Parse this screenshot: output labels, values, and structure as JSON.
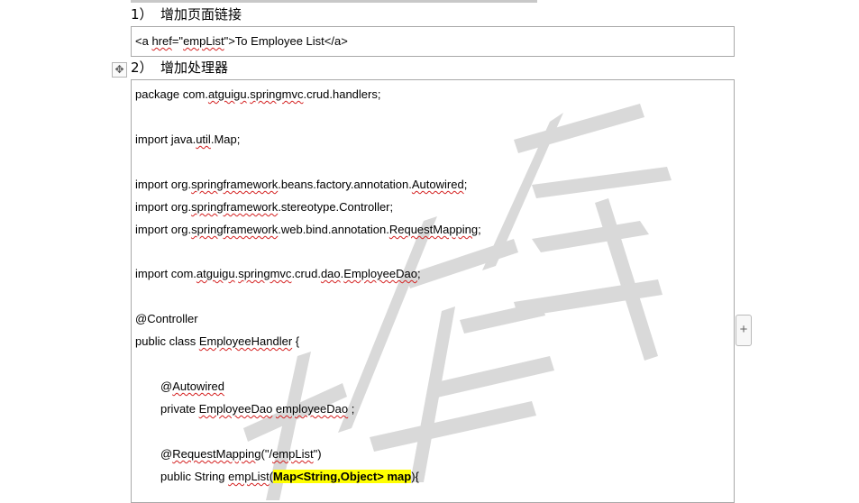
{
  "step1": {
    "number": "1）",
    "title": "增加页面链接",
    "code": "<a href=\"empList\">To Employee List</a>"
  },
  "step2": {
    "number": "2）",
    "title": "增加处理器"
  },
  "code": {
    "l1_a": "package com.",
    "l1_b": "atguigu",
    "l1_c": ".",
    "l1_d": "springmvc",
    "l1_e": ".crud.handlers;",
    "l2_a": "import java.",
    "l2_b": "util",
    "l2_c": ".Map;",
    "l3_a": "import org.",
    "l3_b": "springframework",
    "l3_c": ".beans.factory.annotation.",
    "l3_d": "Autowired",
    "l3_e": ";",
    "l4_a": "import org.",
    "l4_b": "springframework",
    "l4_c": ".stereotype.Controller;",
    "l5_a": "import org.",
    "l5_b": "springframework",
    "l5_c": ".web.bind.annotation.",
    "l5_d": "RequestMapping",
    "l5_e": ";",
    "l6_a": "import com.",
    "l6_b": "atguigu",
    "l6_c": ".",
    "l6_d": "springmvc",
    "l6_e": ".crud.",
    "l6_f": "dao",
    "l6_g": ".",
    "l6_h": "EmployeeDao",
    "l6_i": ";",
    "l7": "@Controller",
    "l8_a": "public class ",
    "l8_b": "EmployeeHandler",
    "l8_c": " {",
    "l9_a": "@",
    "l9_b": "Autowired",
    "l10_a": "private ",
    "l10_b": "EmployeeDao",
    "l10_c": " ",
    "l10_d": "employeeDao",
    "l10_e": " ;",
    "l11_a": "@",
    "l11_b": "RequestMapping",
    "l11_c": "(\"/",
    "l11_d": "empList",
    "l11_e": "\")",
    "l12_a": "public String ",
    "l12_b": "empList",
    "l12_c": "(",
    "l12_d": "Map<String,Object> map",
    "l12_e": "){"
  },
  "watermark_text": "尚硅谷"
}
